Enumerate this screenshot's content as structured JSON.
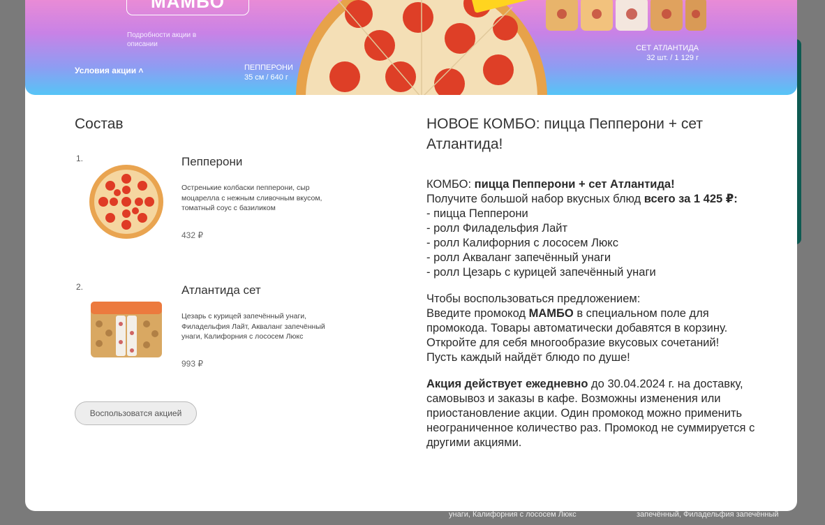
{
  "banner": {
    "promo_code": "МАМБО",
    "hint": "Подробности акции в описании",
    "conditions_link": "Условия акции ˄",
    "pizza_caption_name": "ПЕППЕРОНИ",
    "pizza_caption_size": "35 см / 640 г",
    "set_caption_name": "СЕТ АТЛАНТИДА",
    "set_caption_size": "32 шт. / 1 129 г"
  },
  "composition": {
    "title": "Состав",
    "items": [
      {
        "num": "1.",
        "name": "Пепперони",
        "desc": "Остренькие колбаски пепперони, сыр моцарелла с нежным сливочным вкусом, томатный соус с базиликом",
        "price": "432 ₽"
      },
      {
        "num": "2.",
        "name": "Атлантида сет",
        "desc": "Цезарь с курицей запечённый унаги, Филадельфия Лайт, Акваланг запечённый унаги, Калифорния с лососем Люкс",
        "price": "993 ₽"
      }
    ],
    "use_button": "Воспользоватся акцией"
  },
  "description": {
    "title": "НОВОЕ КОМБО: пицца Пепперони + сет Атлантида!",
    "combo_prefix": "КОМБО: ",
    "combo_bold": "пицца Пепперони + сет Атлантида!",
    "price_prefix": "Получите большой набор вкусных блюд ",
    "price_bold": "всего за 1 425 ₽:",
    "list": [
      "- пицца Пепперони",
      "- ролл Филадельфия Лайт",
      "- ролл Калифорния с лососем Люкс",
      "- ролл Акваланг запечённый унаги",
      "- ролл Цезарь с курицей запечённый унаги"
    ],
    "how_to": "Чтобы воспользоваться предложением:",
    "enter_prefix": "Введите промокод ",
    "enter_code": "МАМБО",
    "enter_suffix": " в специальном поле для промокода. Товары автоматически добавятся в корзину.",
    "discover": "Откройте для себя многообразие вкусовых сочетаний!",
    "wish": "Пусть каждый найдёт блюдо по душе!",
    "terms_bold": "Акция действует ежедневно",
    "terms_text": " до 30.04.2024 г. на доставку, самовывоз и заказы в кафе. Возможны изменения или приостановление акции. Один промокод можно применить неограниченное количество раз. Промокод не суммируется с другими акциями."
  },
  "background": {
    "text_left": "унаги, Калифорния с лососем Люкс",
    "text_right": "запечённый, Филадельфия запечённый"
  }
}
